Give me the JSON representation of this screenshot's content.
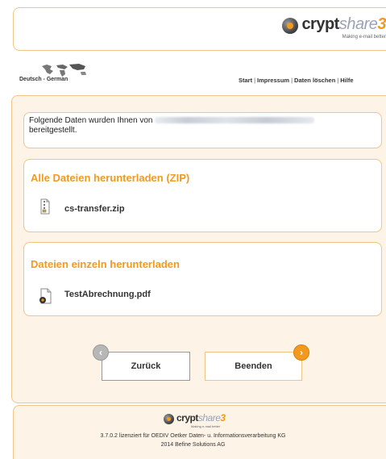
{
  "header": {
    "logo_brand": "crypt",
    "logo_share": "share",
    "logo_version": "3",
    "logo_tagline": "Making e-mail better"
  },
  "language": {
    "label": "Deutsch - German",
    "icon": "world-map-icon"
  },
  "topnav": {
    "items": [
      "Start",
      "Impressum",
      "Daten löschen",
      "Hilfe"
    ]
  },
  "message": {
    "text_before": "Folgende Daten wurden Ihnen von",
    "text_after": "bereitgestellt."
  },
  "zip_section": {
    "title": "Alle Dateien herunterladen (ZIP)",
    "file_name": "cs-transfer.zip",
    "icon": "zip-file-icon"
  },
  "single_section": {
    "title": "Dateien einzeln herunterladen",
    "files": [
      {
        "name": "TestAbrechnung.pdf",
        "icon": "pdf-file-icon"
      }
    ]
  },
  "buttons": {
    "back_label": "Zurück",
    "back_icon": "arrow-left-icon",
    "finish_label": "Beenden",
    "finish_icon": "arrow-right-icon"
  },
  "footer": {
    "logo_brand": "crypt",
    "logo_share": "share",
    "logo_version": "3",
    "logo_tagline": "Making e-mail better",
    "license_line": "3.7.0.2 lizenziert für OEDIV Oetker Daten- u. Informationsverarbeitung KG",
    "copyright_line": "2014 Befine Solutions AG"
  },
  "colors": {
    "accent": "#f39a1e",
    "border": "#f1c48a",
    "panel_bg": "#fdf3e6"
  }
}
